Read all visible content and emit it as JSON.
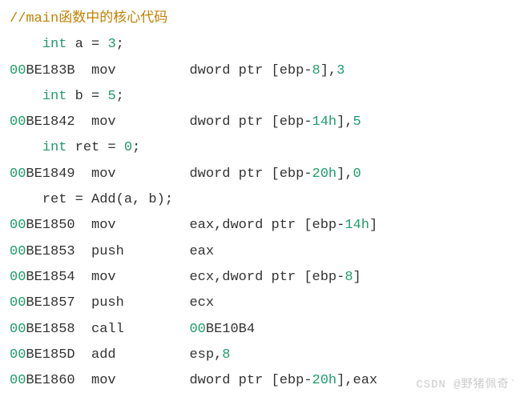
{
  "comment": "//main函数中的核心代码",
  "lines": [
    {
      "kind": "src",
      "indent": "    ",
      "kw": "int",
      "rest": " a = ",
      "num": "3",
      "tail": ";"
    },
    {
      "kind": "asm",
      "addr_p": "00",
      "addr": "BE183B",
      "mnem": "mov ",
      "gap": "        ",
      "ops": [
        {
          "t": "dword ptr ",
          "c": "text"
        },
        {
          "t": "[",
          "c": "op-brack"
        },
        {
          "t": "ebp",
          "c": "op-reg"
        },
        {
          "t": "-",
          "c": "op-neg"
        },
        {
          "t": "8",
          "c": "number"
        },
        {
          "t": "]",
          "c": "op-brack"
        },
        {
          "t": ",",
          "c": "text"
        },
        {
          "t": "3",
          "c": "number"
        }
      ]
    },
    {
      "kind": "src",
      "indent": "    ",
      "kw": "int",
      "rest": " b = ",
      "num": "5",
      "tail": ";"
    },
    {
      "kind": "asm",
      "addr_p": "00",
      "addr": "BE1842",
      "mnem": "mov ",
      "gap": "        ",
      "ops": [
        {
          "t": "dword ptr ",
          "c": "text"
        },
        {
          "t": "[",
          "c": "op-brack"
        },
        {
          "t": "ebp",
          "c": "op-reg"
        },
        {
          "t": "-",
          "c": "op-neg"
        },
        {
          "t": "14h",
          "c": "number"
        },
        {
          "t": "]",
          "c": "op-brack"
        },
        {
          "t": ",",
          "c": "text"
        },
        {
          "t": "5",
          "c": "number"
        }
      ]
    },
    {
      "kind": "src",
      "indent": "    ",
      "kw": "int",
      "rest": " ret = ",
      "num": "0",
      "tail": ";"
    },
    {
      "kind": "asm",
      "addr_p": "00",
      "addr": "BE1849",
      "mnem": "mov ",
      "gap": "        ",
      "ops": [
        {
          "t": "dword ptr ",
          "c": "text"
        },
        {
          "t": "[",
          "c": "op-brack"
        },
        {
          "t": "ebp",
          "c": "op-reg"
        },
        {
          "t": "-",
          "c": "op-neg"
        },
        {
          "t": "20h",
          "c": "number"
        },
        {
          "t": "]",
          "c": "op-brack"
        },
        {
          "t": ",",
          "c": "text"
        },
        {
          "t": "0",
          "c": "number"
        }
      ]
    },
    {
      "kind": "srcx",
      "indent": "    ",
      "text": "ret = Add(a, b);"
    },
    {
      "kind": "asm",
      "addr_p": "00",
      "addr": "BE1850",
      "mnem": "mov ",
      "gap": "        ",
      "ops": [
        {
          "t": "eax,",
          "c": "text"
        },
        {
          "t": "dword ptr ",
          "c": "text"
        },
        {
          "t": "[",
          "c": "op-brack"
        },
        {
          "t": "ebp",
          "c": "op-reg"
        },
        {
          "t": "-",
          "c": "op-neg"
        },
        {
          "t": "14h",
          "c": "number"
        },
        {
          "t": "]",
          "c": "op-brack"
        }
      ]
    },
    {
      "kind": "asm",
      "addr_p": "00",
      "addr": "BE1853",
      "mnem": "push",
      "gap": "        ",
      "ops": [
        {
          "t": "eax",
          "c": "text"
        }
      ]
    },
    {
      "kind": "asm",
      "addr_p": "00",
      "addr": "BE1854",
      "mnem": "mov ",
      "gap": "        ",
      "ops": [
        {
          "t": "ecx,",
          "c": "text"
        },
        {
          "t": "dword ptr ",
          "c": "text"
        },
        {
          "t": "[",
          "c": "op-brack"
        },
        {
          "t": "ebp",
          "c": "op-reg"
        },
        {
          "t": "-",
          "c": "op-neg"
        },
        {
          "t": "8",
          "c": "number"
        },
        {
          "t": "]",
          "c": "op-brack"
        }
      ]
    },
    {
      "kind": "asm",
      "addr_p": "00",
      "addr": "BE1857",
      "mnem": "push",
      "gap": "        ",
      "ops": [
        {
          "t": "ecx",
          "c": "text"
        }
      ]
    },
    {
      "kind": "asm",
      "addr_p": "00",
      "addr": "BE1858",
      "mnem": "call",
      "gap": "        ",
      "ops": [
        {
          "t": "00",
          "c": "number"
        },
        {
          "t": "BE10B4",
          "c": "text"
        }
      ]
    },
    {
      "kind": "asm",
      "addr_p": "00",
      "addr": "BE185D",
      "mnem": "add ",
      "gap": "        ",
      "ops": [
        {
          "t": "esp,",
          "c": "text"
        },
        {
          "t": "8",
          "c": "number"
        }
      ]
    },
    {
      "kind": "asm",
      "addr_p": "00",
      "addr": "BE1860",
      "mnem": "mov ",
      "gap": "        ",
      "ops": [
        {
          "t": "dword ptr ",
          "c": "text"
        },
        {
          "t": "[",
          "c": "op-brack"
        },
        {
          "t": "ebp",
          "c": "op-reg"
        },
        {
          "t": "-",
          "c": "op-neg"
        },
        {
          "t": "20h",
          "c": "number"
        },
        {
          "t": "]",
          "c": "op-brack"
        },
        {
          "t": ",",
          "c": "text"
        },
        {
          "t": "eax",
          "c": "text"
        }
      ]
    }
  ],
  "watermark": "CSDN @野猪佩奇`"
}
